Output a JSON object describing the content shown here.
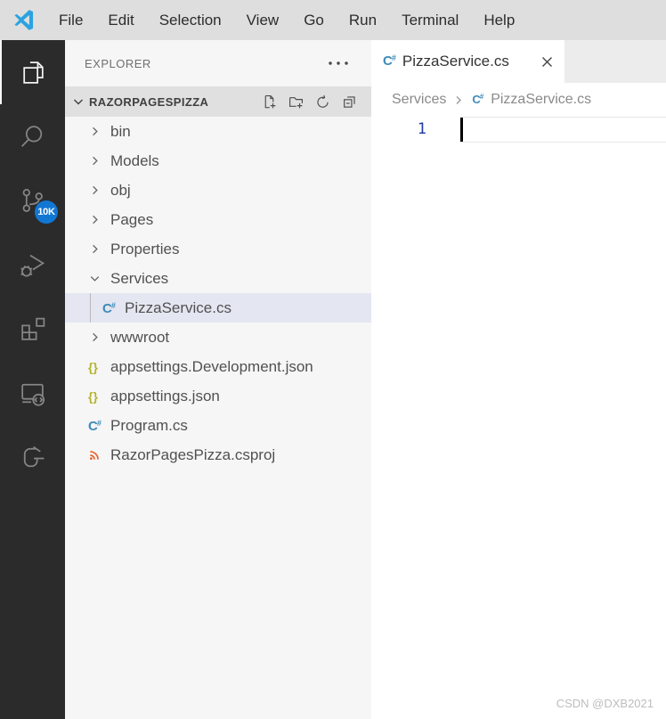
{
  "menubar": {
    "items": [
      "File",
      "Edit",
      "Selection",
      "View",
      "Go",
      "Run",
      "Terminal",
      "Help"
    ]
  },
  "activity_bar": {
    "items": [
      "explorer",
      "search",
      "source-control",
      "run-and-debug",
      "extensions",
      "remote-explorer",
      "custom-extension"
    ],
    "active_item": "explorer",
    "source_control_badge": "10K"
  },
  "sidebar": {
    "title": "EXPLORER",
    "section": {
      "label": "RAZORPAGESPIZZA",
      "actions": [
        "new-file",
        "new-folder",
        "refresh-explorer",
        "collapse-folders"
      ]
    },
    "tree": [
      {
        "label": "bin",
        "kind": "folder",
        "state": "collapsed"
      },
      {
        "label": "Models",
        "kind": "folder",
        "state": "collapsed"
      },
      {
        "label": "obj",
        "kind": "folder",
        "state": "collapsed"
      },
      {
        "label": "Pages",
        "kind": "folder",
        "state": "collapsed"
      },
      {
        "label": "Properties",
        "kind": "folder",
        "state": "collapsed"
      },
      {
        "label": "Services",
        "kind": "folder",
        "state": "expanded"
      },
      {
        "label": "PizzaService.cs",
        "kind": "file",
        "icon": "csharp",
        "selected": true
      },
      {
        "label": "wwwroot",
        "kind": "folder",
        "state": "collapsed"
      },
      {
        "label": "appsettings.Development.json",
        "kind": "file",
        "icon": "json"
      },
      {
        "label": "appsettings.json",
        "kind": "file",
        "icon": "json"
      },
      {
        "label": "Program.cs",
        "kind": "file",
        "icon": "csharp"
      },
      {
        "label": "RazorPagesPizza.csproj",
        "kind": "file",
        "icon": "rss"
      }
    ]
  },
  "editor": {
    "tab": {
      "title": "PizzaService.cs",
      "icon": "csharp",
      "active": true
    },
    "breadcrumbs": {
      "folder": "Services",
      "file": "PizzaService.cs"
    },
    "line_number": "1",
    "watermark": "CSDN @DXB2021"
  },
  "icon_text": {
    "csharp_c": "C",
    "csharp_hash": "#",
    "json_braces": "{}"
  },
  "colors": {
    "accent_badge": "#1277d3",
    "selection": "#e4e6f1",
    "activity_bar_bg": "#2b2b2b",
    "titlebar_bg": "#dedede",
    "sidebar_bg": "#f6f6f6",
    "section_header_bg": "#e0e0e0",
    "tabbar_bg": "#ececec",
    "csharp_icon": "#3c8bb8",
    "json_icon": "#b5b42c",
    "csproj_icon": "#e2662d",
    "line_number": "#1f3ba6"
  }
}
